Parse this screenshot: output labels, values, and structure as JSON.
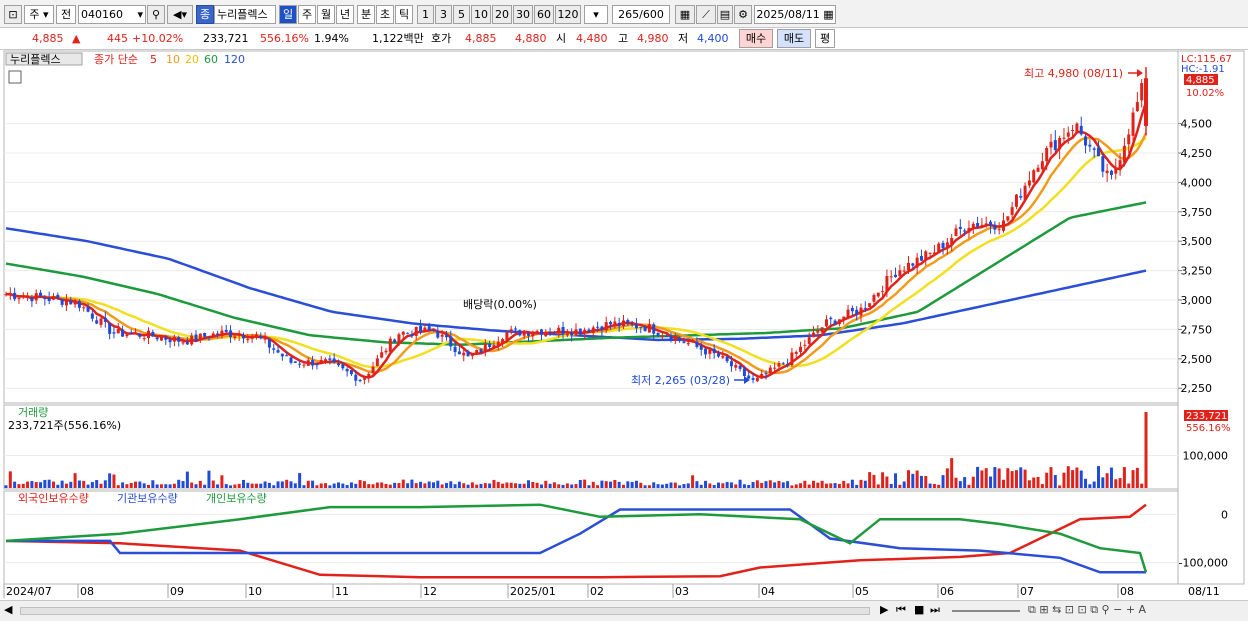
{
  "toolbar": {
    "market": "주",
    "prev": "전",
    "code": "040160",
    "name": "누리플렉스",
    "name_badge": "종",
    "periods": [
      "일",
      "주",
      "월",
      "년",
      "분",
      "초",
      "틱"
    ],
    "active_period": "일",
    "intervals": [
      "1",
      "3",
      "5",
      "10",
      "20",
      "30",
      "60",
      "120"
    ],
    "count": "265",
    "total": "/600",
    "date": "2025/08/11"
  },
  "quote": {
    "price": "4,885",
    "arrow": "▲",
    "change": "445",
    "change_pct": "+10.02%",
    "volume": "233,721",
    "volume_pct": "556.16%",
    "turnover_pct": "1.94%",
    "amount": "1,122백만",
    "hoga_label": "호가",
    "ask": "4,885",
    "bid": "4,880",
    "open_label": "시",
    "open": "4,480",
    "high_label": "고",
    "high": "4,980",
    "low_label": "저",
    "low": "4,400",
    "buy": "매수",
    "sell": "매도",
    "eval": "평"
  },
  "price_panel": {
    "name": "누리플렉스",
    "legend_title": "종가 단순",
    "ma_periods": [
      "5",
      "10",
      "20",
      "60",
      "120"
    ],
    "ma_colors": [
      "#e0221b",
      "#f29b1a",
      "#f0e020",
      "#1e9a3c",
      "#2a4fd6"
    ],
    "lc_label": "LC:115.67",
    "hc_label": "HC:-1.91",
    "current_price_tag": "4,885",
    "current_pct_tag": "10.02%",
    "high_annotation": "최고 4,980 (08/11)",
    "low_annotation": "최저 2,265 (03/28)",
    "dividend_annotation": "배당락(0.00%)",
    "y_ticks": [
      "4,500",
      "4,250",
      "4,000",
      "3,750",
      "3,500",
      "3,250",
      "3,000",
      "2,750",
      "2,500",
      "2,250"
    ]
  },
  "volume_panel": {
    "title": "거래량",
    "subtitle": "233,721주(556.16%)",
    "tag_value": "233,721",
    "tag_pct": "556.16%",
    "y_ticks": [
      "100,000"
    ]
  },
  "holdings_panel": {
    "legend": [
      "외국인보유수량",
      "기관보유수량",
      "개인보유수량"
    ],
    "legend_colors": [
      "#e0221b",
      "#2a4fd6",
      "#1e9a3c"
    ],
    "y_ticks": [
      "0",
      "-100,000"
    ]
  },
  "x_axis": {
    "labels": [
      "2024/07",
      "08",
      "09",
      "10",
      "11",
      "12",
      "2025/01",
      "02",
      "03",
      "04",
      "05",
      "06",
      "07",
      "08"
    ],
    "right_label": "08/11"
  },
  "chart_data": [
    {
      "type": "candlestick",
      "title": "누리플렉스",
      "x_range": [
        "2024/07",
        "2025/08/11"
      ],
      "ylim": [
        2150,
        5100
      ],
      "close_series": [
        {
          "t": "2024/07",
          "v": 3050
        },
        {
          "t": "2024/07 mid",
          "v": 3020
        },
        {
          "t": "2024/08",
          "v": 2980
        },
        {
          "t": "2024/08 mid",
          "v": 2720
        },
        {
          "t": "2024/09",
          "v": 2700
        },
        {
          "t": "2024/09 mid",
          "v": 2650
        },
        {
          "t": "2024/10",
          "v": 2720
        },
        {
          "t": "2024/10 mid",
          "v": 2700
        },
        {
          "t": "2024/10 late",
          "v": 2470
        },
        {
          "t": "2024/11",
          "v": 2470
        },
        {
          "t": "2024/11 mid",
          "v": 2320
        },
        {
          "t": "2024/11 late",
          "v": 2720
        },
        {
          "t": "2024/12",
          "v": 2740
        },
        {
          "t": "2024/12 mid",
          "v": 2500
        },
        {
          "t": "2024/12 late",
          "v": 2720
        },
        {
          "t": "2025/01",
          "v": 2740
        },
        {
          "t": "2025/01 mid",
          "v": 2740
        },
        {
          "t": "2025/02",
          "v": 2800
        },
        {
          "t": "2025/02 mid",
          "v": 2770
        },
        {
          "t": "2025/03",
          "v": 2650
        },
        {
          "t": "2025/03 mid",
          "v": 2520
        },
        {
          "t": "2025/03/28",
          "v": 2300
        },
        {
          "t": "2025/04",
          "v": 2500
        },
        {
          "t": "2025/04 mid",
          "v": 2800
        },
        {
          "t": "2025/05",
          "v": 2920
        },
        {
          "t": "2025/05 mid",
          "v": 3250
        },
        {
          "t": "2025/06",
          "v": 3400
        },
        {
          "t": "2025/06 mid",
          "v": 3650
        },
        {
          "t": "2025/07",
          "v": 3650
        },
        {
          "t": "2025/07 mid",
          "v": 4200
        },
        {
          "t": "2025/07 late",
          "v": 4500
        },
        {
          "t": "2025/08",
          "v": 4000
        },
        {
          "t": "2025/08/11",
          "v": 4885
        }
      ],
      "moving_averages": [
        {
          "name": "5",
          "color": "#e0221b"
        },
        {
          "name": "10",
          "color": "#f29b1a"
        },
        {
          "name": "20",
          "color": "#f0e020"
        },
        {
          "name": "60",
          "color": "#1e9a3c",
          "values": [
            3310,
            3200,
            3050,
            2850,
            2700,
            2640,
            2620,
            2650,
            2680,
            2700,
            2720,
            2760,
            2900,
            3300,
            3700,
            3830
          ]
        },
        {
          "name": "120",
          "color": "#2a4fd6",
          "values": [
            3610,
            3500,
            3350,
            3100,
            2900,
            2800,
            2740,
            2700,
            2660,
            2670,
            2700,
            2800,
            2950,
            3100,
            3250
          ]
        }
      ]
    },
    {
      "type": "bar",
      "title": "거래량",
      "ylim": [
        0,
        240000
      ],
      "note": "daily volume bars; last bar 233,721"
    },
    {
      "type": "line",
      "series": [
        {
          "name": "외국인보유수량",
          "color": "#e0221b"
        },
        {
          "name": "기관보유수량",
          "color": "#2a4fd6"
        },
        {
          "name": "개인보유수량",
          "color": "#1e9a3c"
        }
      ],
      "ylim": [
        -140000,
        40000
      ]
    }
  ],
  "bottombar": {
    "nav": [
      "▶",
      "⏮",
      "■",
      "⏭"
    ]
  }
}
